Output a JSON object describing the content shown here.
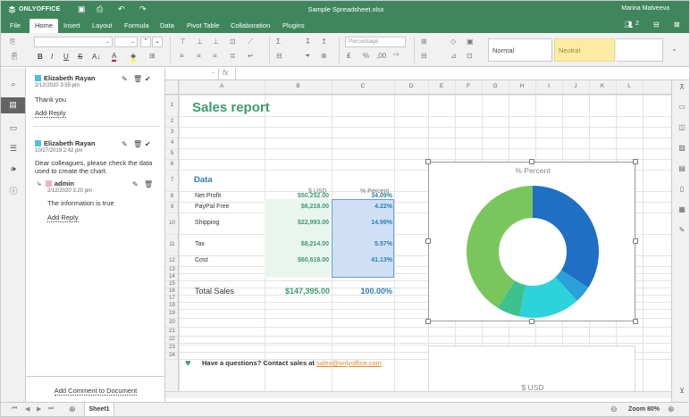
{
  "app": {
    "brand": "ONLYOFFICE",
    "file_name": "Sample Spreadsheet.xlsx",
    "user": "Marina Matveeva",
    "users_count": "2"
  },
  "menu": {
    "tabs": [
      "File",
      "Home",
      "Insert",
      "Layout",
      "Formula",
      "Data",
      "Pivot Table",
      "Collaboration",
      "Plugins"
    ],
    "active": "Home"
  },
  "toolbar": {
    "number_format": "Percentage",
    "styles": [
      "Normal",
      "Neutral"
    ]
  },
  "comments": {
    "items": [
      {
        "author": "Elizabeth Rayan",
        "date": "2/12/2020 3:55 pm",
        "text": "Thank you",
        "reply_label": "Add Reply",
        "color": "#4ac3d9"
      },
      {
        "author": "Elizabeth Rayan",
        "date": "10/27/2019 2:42 pm",
        "text_line1": "Dear colleagues, please check the data",
        "text_line2": "used to create the chart.",
        "color": "#4ac3d9",
        "reply": {
          "author": "admin",
          "date": "2/12/2020 3:20 pm",
          "text": "The information is true",
          "reply_label": "Add Reply",
          "color": "#f0b0c8"
        }
      }
    ],
    "add_comment_label": "Add Comment to Document"
  },
  "columns": [
    "A",
    "B",
    "C",
    "D",
    "E",
    "F",
    "G",
    "H",
    "I",
    "J",
    "K",
    "L"
  ],
  "rows": [
    "1",
    "2",
    "3",
    "4",
    "5",
    "6",
    "7",
    "8",
    "9",
    "10",
    "11",
    "12",
    "13",
    "14",
    "15",
    "16",
    "17",
    "18",
    "19",
    "20",
    "21",
    "22",
    "23",
    "24"
  ],
  "sheet": {
    "title": "Sales report",
    "data_heading": "Data",
    "col_usd": "$ USD",
    "col_pct": "% Percent",
    "items": [
      {
        "label": "Net Profit",
        "usd": "$50,252.00",
        "pct": "34.09%"
      },
      {
        "label": "PayPal Free",
        "usd": "$6,218.00",
        "pct": "4.22%"
      },
      {
        "label": "Shipping",
        "usd": "$22,993.00",
        "pct": "14.99%"
      },
      {
        "label": "Tax",
        "usd": "$8,214.00",
        "pct": "5.57%"
      },
      {
        "label": "Cost",
        "usd": "$60,618.00",
        "pct": "41.13%"
      }
    ],
    "total_label": "Total Sales",
    "total_usd": "$147,395.00",
    "total_pct": "100.00%",
    "contact_text": "Have a questions? Contact sales at ",
    "contact_email": "sales@onlyoffice.com",
    "second_chart_title": "$ USD"
  },
  "chart_data": {
    "type": "pie",
    "title": "% Percent",
    "categories": [
      "Net Profit",
      "PayPal Free",
      "Shipping",
      "Tax",
      "Cost"
    ],
    "values": [
      34.09,
      4.22,
      14.99,
      5.57,
      41.13
    ],
    "colors": [
      "#1f6fc5",
      "#2b9fd8",
      "#2cd3d9",
      "#3dc28f",
      "#79c65d"
    ],
    "donut": true
  },
  "status": {
    "sheet_tab": "Sheet1",
    "zoom": "Zoom 80%"
  }
}
